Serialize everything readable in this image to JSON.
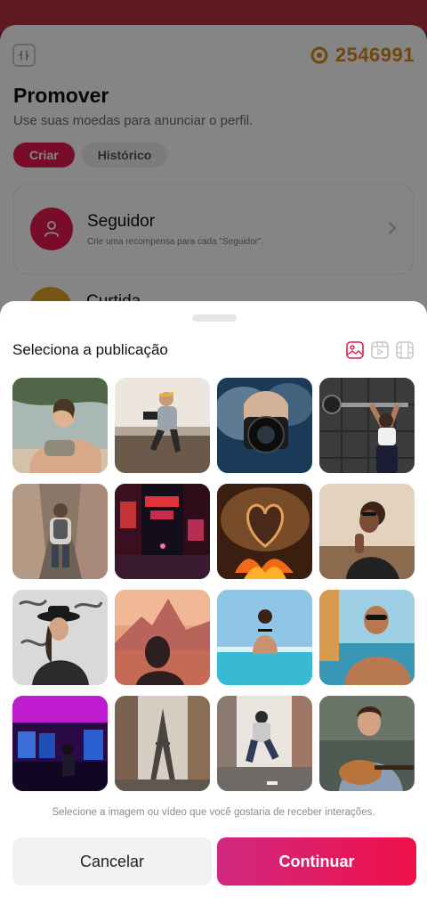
{
  "colors": {
    "accent": "#e8194f",
    "coin": "#d8891a",
    "strip": "#b5323f"
  },
  "header": {
    "coins_value": "2546991",
    "title": "Promover",
    "subtitle": "Use suas moedas para anunciar o perfil."
  },
  "tabs": [
    {
      "label": "Criar",
      "active": true
    },
    {
      "label": "Histórico",
      "active": false
    }
  ],
  "rewards": [
    {
      "title": "Seguidor",
      "description": "Crie uma recompensa para cada \"Seguidor\".",
      "icon": "user-icon"
    },
    {
      "title": "Curtida",
      "description": "",
      "icon": "heart-icon"
    }
  ],
  "sheet": {
    "title": "Seleciona a publicação",
    "filters": [
      {
        "name": "image-filter-icon",
        "active": true
      },
      {
        "name": "reels-filter-icon",
        "active": false
      },
      {
        "name": "video-filter-icon",
        "active": false
      }
    ],
    "thumbnails": [
      "woman-resting-outdoors",
      "photographer-on-rock",
      "camera-in-smoke",
      "gym-pullup",
      "woman-in-alley",
      "neon-street",
      "heart-hands-fire",
      "smiling-woman",
      "woman-with-hat",
      "woman-sunset-mountains",
      "woman-in-pool",
      "man-at-beach",
      "arcade-neon",
      "eiffel-tower-street",
      "man-jumping-street",
      "man-with-guitar"
    ],
    "hint": "Selecione a imagem ou vídeo que você gostaria de receber interações.",
    "cancel_label": "Cancelar",
    "continue_label": "Continuar"
  }
}
